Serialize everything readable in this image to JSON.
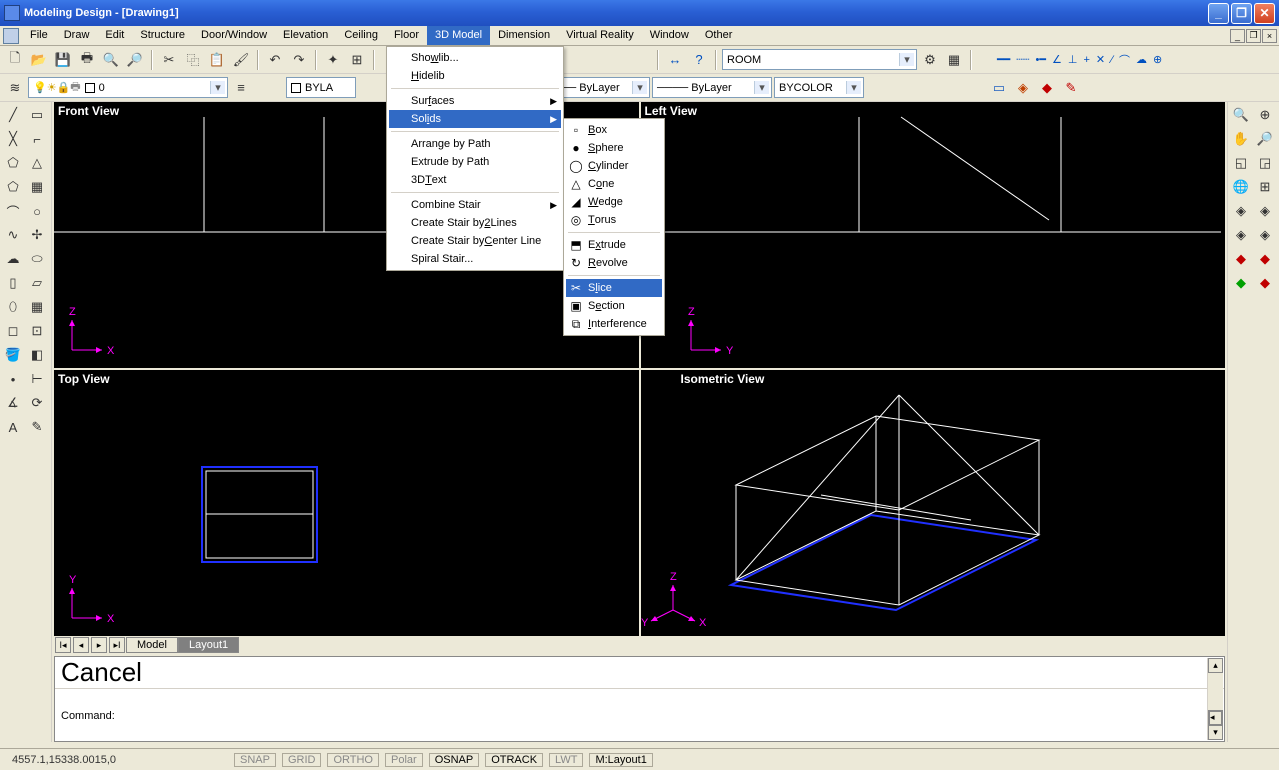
{
  "title": "Modeling Design - [Drawing1]",
  "menubar": [
    "File",
    "Draw",
    "Edit",
    "Structure",
    "Door/Window",
    "Elevation",
    "Ceiling",
    "Floor",
    "3D Model",
    "Dimension",
    "Virtual Reality",
    "Window",
    "Other"
  ],
  "active_menu": "3D Model",
  "menu_3d": {
    "items": [
      {
        "label": "Showlib...",
        "sub": false
      },
      {
        "label": "Hidelib",
        "sub": false
      },
      {
        "sep": true
      },
      {
        "label": "Surfaces",
        "sub": true
      },
      {
        "label": "Solids",
        "sub": true,
        "highlight": true
      },
      {
        "sep": true
      },
      {
        "label": "Arrange by Path",
        "sub": false
      },
      {
        "label": "Extrude by Path",
        "sub": false
      },
      {
        "label": "3D Text",
        "sub": false
      },
      {
        "sep": true
      },
      {
        "label": "Combine Stair",
        "sub": true
      },
      {
        "label": "Create Stair by 2 Lines",
        "sub": false
      },
      {
        "label": "Create Stair by Center Line",
        "sub": false
      },
      {
        "label": "Spiral Stair...",
        "sub": false
      }
    ]
  },
  "menu_solids": {
    "items": [
      {
        "icon": "□",
        "label": "Box"
      },
      {
        "icon": "●",
        "label": "Sphere"
      },
      {
        "icon": "◯",
        "label": "Cylinder"
      },
      {
        "icon": "△",
        "label": "Cone"
      },
      {
        "icon": "◢",
        "label": "Wedge"
      },
      {
        "icon": "◎",
        "label": "Torus"
      },
      {
        "sep": true
      },
      {
        "icon": "⬒",
        "label": "Extrude"
      },
      {
        "icon": "↻",
        "label": "Revolve"
      },
      {
        "sep": true
      },
      {
        "icon": "✂",
        "label": "Slice",
        "highlight": true
      },
      {
        "icon": "▣",
        "label": "Section"
      },
      {
        "icon": "⧉",
        "label": "Interference"
      }
    ]
  },
  "toolbar2": {
    "layer_dropdown": "0",
    "bylayer1": "ByLayer",
    "bylayer2": "ByLayer",
    "bycolor": "BYCOLOR",
    "bylat": "BYLA",
    "room": "ROOM"
  },
  "viewports": {
    "front": "Front View",
    "left": "Left View",
    "top": "Top View",
    "iso": "Isometric View"
  },
  "tabs": {
    "model": "Model",
    "layout": "Layout1"
  },
  "command": {
    "hist": "Cancel",
    "prompt": "Command:"
  },
  "status": {
    "coords": "4557.1,15338.0015,0",
    "snap": "SNAP",
    "grid": "GRID",
    "ortho": "ORTHO",
    "polar": "Polar",
    "osnap": "OSNAP",
    "otrack": "OTRACK",
    "lwt": "LWT",
    "mlayout": "M:Layout1"
  }
}
